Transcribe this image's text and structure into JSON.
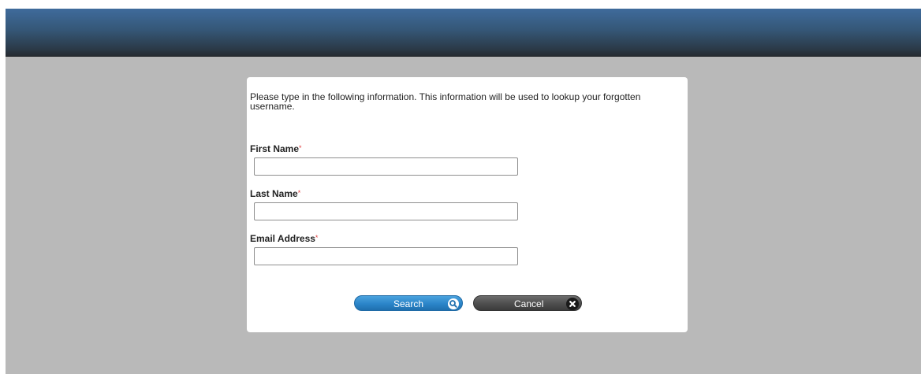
{
  "form": {
    "intro_text": "Please type in the following information. This information will be used to lookup your forgotten username.",
    "required_marker": "*",
    "fields": [
      {
        "label": "First Name",
        "value": "",
        "placeholder": ""
      },
      {
        "label": "Last Name",
        "value": "",
        "placeholder": ""
      },
      {
        "label": "Email Address",
        "value": "",
        "placeholder": ""
      }
    ]
  },
  "actions": {
    "search_label": "Search",
    "search_icon": "search-icon",
    "cancel_label": "Cancel",
    "cancel_icon": "close-icon"
  },
  "colors": {
    "header_top": "#3f6b9c",
    "header_bottom": "#262b31",
    "background": "#b9b9b9",
    "panel": "#ffffff",
    "search_button": "#2b85c9",
    "cancel_button": "#4e4e4e",
    "required": "#e04040"
  }
}
